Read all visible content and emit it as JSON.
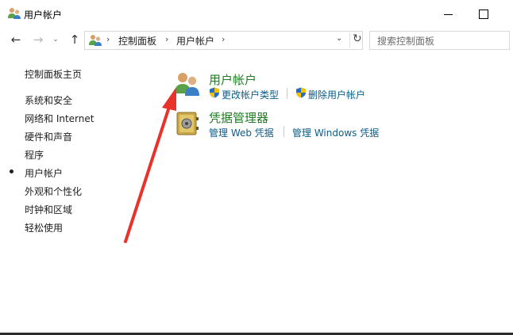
{
  "window": {
    "title": "用户帐户"
  },
  "address_bar": {
    "breadcrumbs": [
      "控制面板",
      "用户帐户"
    ],
    "search_placeholder": "搜索控制面板"
  },
  "sidebar": {
    "home": "控制面板主页",
    "items": [
      {
        "label": "系统和安全",
        "active": false
      },
      {
        "label": "网络和 Internet",
        "active": false
      },
      {
        "label": "硬件和声音",
        "active": false
      },
      {
        "label": "程序",
        "active": false
      },
      {
        "label": "用户帐户",
        "active": true
      },
      {
        "label": "外观和个性化",
        "active": false
      },
      {
        "label": "时钟和区域",
        "active": false
      },
      {
        "label": "轻松使用",
        "active": false
      }
    ]
  },
  "main": {
    "categories": [
      {
        "title": "用户帐户",
        "icon": "users-icon",
        "tasks": [
          "更改帐户类型",
          "删除用户帐户"
        ]
      },
      {
        "title": "凭据管理器",
        "icon": "vault-icon",
        "tasks": [
          "管理 Web 凭据",
          "管理 Windows 凭据"
        ]
      }
    ]
  },
  "annotation": {
    "arrow_color": "#e8322a"
  }
}
